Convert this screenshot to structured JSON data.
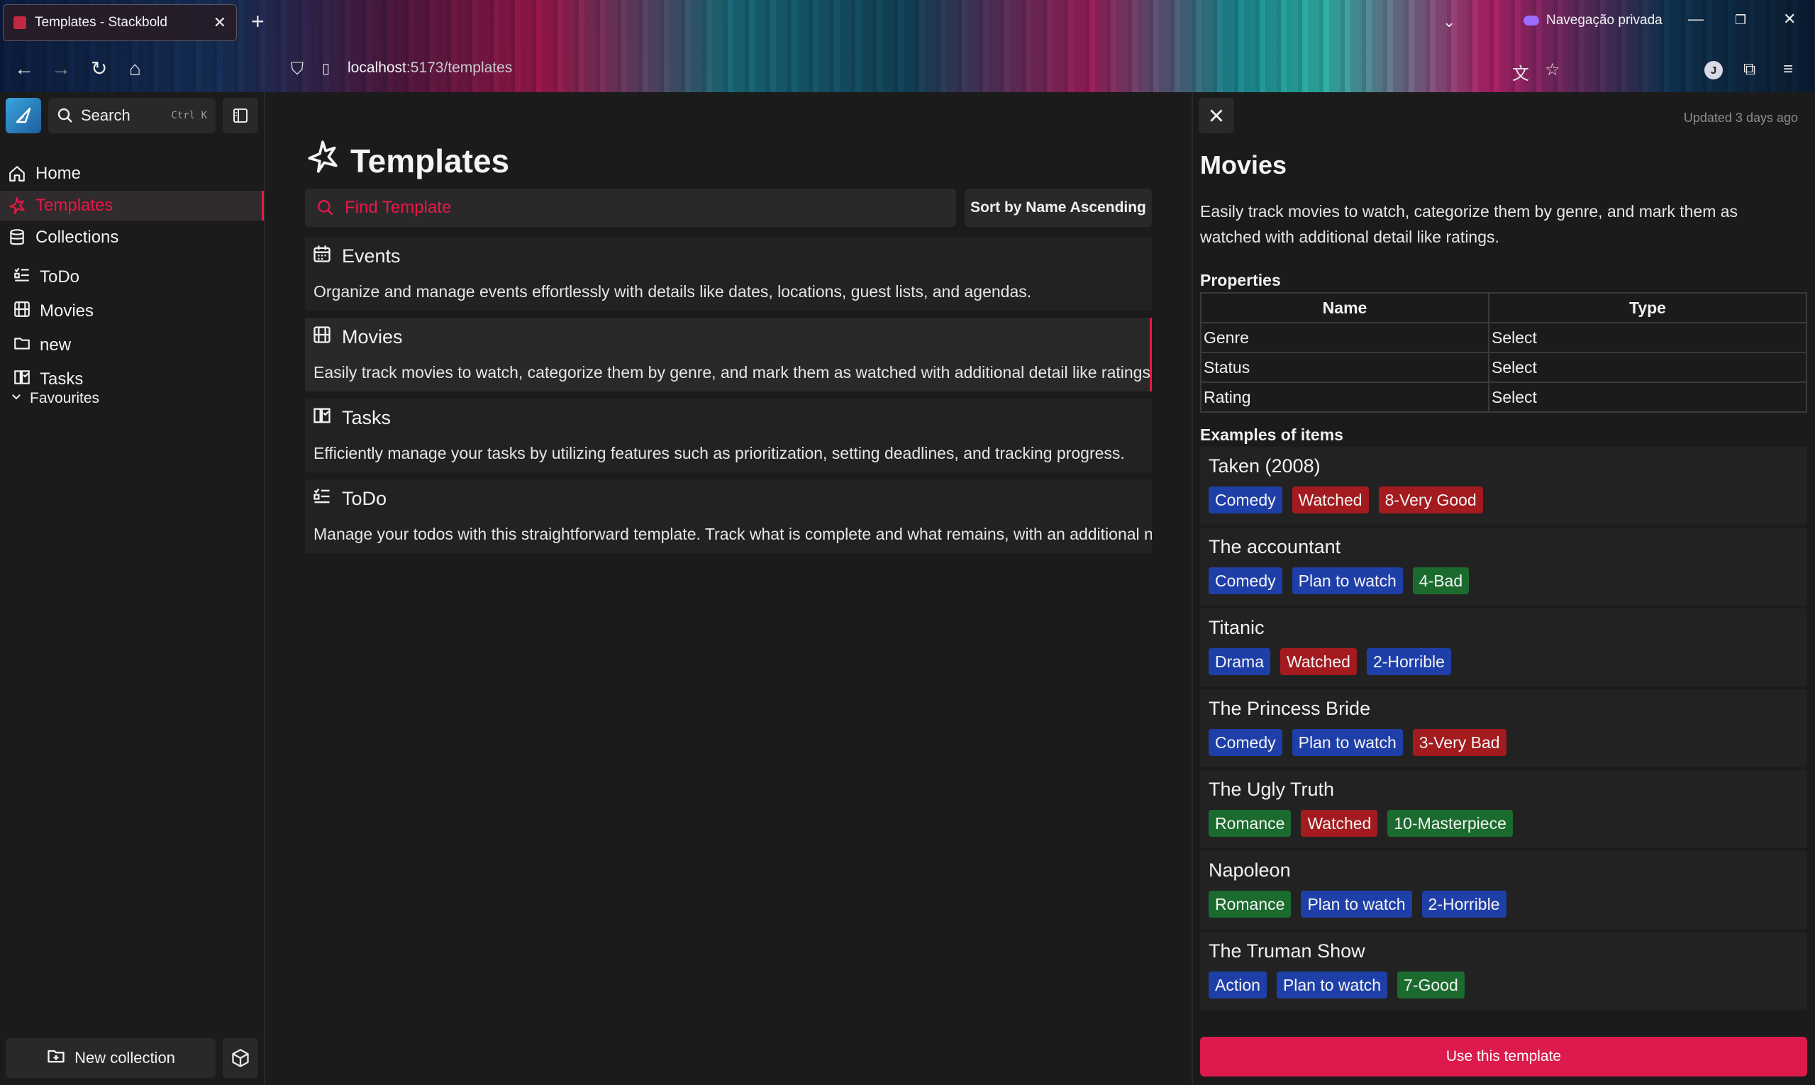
{
  "browser": {
    "tab_title": "Templates - Stackbold",
    "url_host": "localhost",
    "url_path": ":5173/templates",
    "private_label": "Navegação privada",
    "profile_initial": "J"
  },
  "sidebar": {
    "search_label": "Search",
    "search_shortcut": "Ctrl K",
    "nav": [
      {
        "label": "Home",
        "icon": "home-icon"
      },
      {
        "label": "Templates",
        "icon": "templates-icon",
        "active": true
      },
      {
        "label": "Collections",
        "icon": "database-icon"
      }
    ],
    "collections": [
      {
        "label": "ToDo",
        "icon": "checklist-icon"
      },
      {
        "label": "Movies",
        "icon": "film-icon"
      },
      {
        "label": "new",
        "icon": "folder-icon"
      },
      {
        "label": "Tasks",
        "icon": "book-icon"
      }
    ],
    "favourites_label": "Favourites",
    "new_collection_label": "New collection"
  },
  "main": {
    "title": "Templates",
    "search_placeholder": "Find Template",
    "sort_label": "Sort by Name Ascending",
    "templates": [
      {
        "name": "Events",
        "icon": "calendar-icon",
        "description": "Organize and manage events effortlessly with details like dates, locations, guest lists, and agendas."
      },
      {
        "name": "Movies",
        "icon": "film-icon",
        "description": "Easily track movies to watch, categorize them by genre, and mark them as watched with additional detail like ratings.",
        "selected": true
      },
      {
        "name": "Tasks",
        "icon": "book-icon",
        "description": "Efficiently manage your tasks by utilizing features such as prioritization, setting deadlines, and tracking progress."
      },
      {
        "name": "ToDo",
        "icon": "checklist-icon",
        "description": "Manage your todos with this straightforward template. Track what is complete and what remains, with an additional note field."
      }
    ]
  },
  "detail": {
    "updated": "Updated 3 days ago",
    "title": "Movies",
    "description": "Easily track movies to watch, categorize them by genre, and mark them as watched with additional detail like ratings.",
    "properties_label": "Properties",
    "properties_headers": [
      "Name",
      "Type"
    ],
    "properties": [
      {
        "name": "Genre",
        "type": "Select"
      },
      {
        "name": "Status",
        "type": "Select"
      },
      {
        "name": "Rating",
        "type": "Select"
      }
    ],
    "examples_label": "Examples of items",
    "examples": [
      {
        "name": "Taken (2008)",
        "tags": [
          {
            "text": "Comedy",
            "color": "#1f3fa8"
          },
          {
            "text": "Watched",
            "color": "#a31b1f"
          },
          {
            "text": "8-Very Good",
            "color": "#a31b1f"
          }
        ]
      },
      {
        "name": "The accountant",
        "tags": [
          {
            "text": "Comedy",
            "color": "#1f3fa8"
          },
          {
            "text": "Plan to watch",
            "color": "#1f3fa8"
          },
          {
            "text": "4-Bad",
            "color": "#1b6b2e"
          }
        ]
      },
      {
        "name": "Titanic",
        "tags": [
          {
            "text": "Drama",
            "color": "#1f3fa8"
          },
          {
            "text": "Watched",
            "color": "#a31b1f"
          },
          {
            "text": "2-Horrible",
            "color": "#1f3fa8"
          }
        ]
      },
      {
        "name": "The Princess Bride",
        "tags": [
          {
            "text": "Comedy",
            "color": "#1f3fa8"
          },
          {
            "text": "Plan to watch",
            "color": "#1f3fa8"
          },
          {
            "text": "3-Very Bad",
            "color": "#a31b1f"
          }
        ]
      },
      {
        "name": "The Ugly Truth",
        "tags": [
          {
            "text": "Romance",
            "color": "#1b6b2e"
          },
          {
            "text": "Watched",
            "color": "#a31b1f"
          },
          {
            "text": "10-Masterpiece",
            "color": "#1b6b2e"
          }
        ]
      },
      {
        "name": "Napoleon",
        "tags": [
          {
            "text": "Romance",
            "color": "#1b6b2e"
          },
          {
            "text": "Plan to watch",
            "color": "#1f3fa8"
          },
          {
            "text": "2-Horrible",
            "color": "#1f3fa8"
          }
        ]
      },
      {
        "name": "The Truman Show",
        "tags": [
          {
            "text": "Action",
            "color": "#1f3fa8"
          },
          {
            "text": "Plan to watch",
            "color": "#1f3fa8"
          },
          {
            "text": "7-Good",
            "color": "#1b6b2e"
          }
        ]
      }
    ],
    "use_button": "Use this template"
  },
  "colors": {
    "accent": "#e6194a",
    "button_primary": "#dc1a4c",
    "tag_blue": "#1f3fa8",
    "tag_red": "#a31b1f",
    "tag_green": "#1b6b2e"
  }
}
